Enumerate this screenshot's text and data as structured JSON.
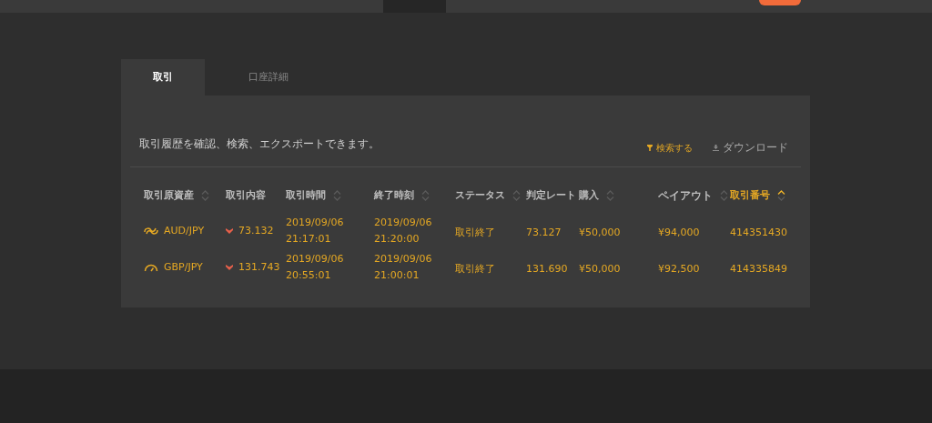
{
  "tabs": [
    {
      "label": "取引",
      "selected": true
    },
    {
      "label": "口座詳細",
      "selected": false
    }
  ],
  "panel": {
    "description": "取引履歴を確認、検索、エクスポートできます。",
    "search_button": "検索する",
    "download_button": "ダウンロード"
  },
  "table": {
    "columns": [
      {
        "label": "取引原資産",
        "sortable": true,
        "selected": false
      },
      {
        "label": "取引内容",
        "sortable": false,
        "selected": false
      },
      {
        "label": "取引時間",
        "sortable": true,
        "selected": false
      },
      {
        "label": "終了時刻",
        "sortable": true,
        "selected": false
      },
      {
        "label": "ステータス",
        "sortable": true,
        "selected": false
      },
      {
        "label": "判定レート",
        "sortable": false,
        "selected": false
      },
      {
        "label": "購入",
        "sortable": true,
        "selected": false
      },
      {
        "label": "ペイアウト",
        "sortable": true,
        "selected": false
      },
      {
        "label": "取引番号",
        "sortable": true,
        "selected": true
      }
    ],
    "rows": [
      {
        "asset": {
          "kind": "coil",
          "label": "AUD/JPY"
        },
        "content": {
          "kind": "down",
          "price": "73.132"
        },
        "start_date": "2019/09/06",
        "start_time": "21:17:01",
        "end_date": "2019/09/06",
        "end_time": "21:20:00",
        "status": "取引終了",
        "rate": "73.127",
        "purchase": "¥50,000",
        "payout": "¥94,000",
        "trade_no": "414351430"
      },
      {
        "asset": {
          "kind": "gauge",
          "label": "GBP/JPY"
        },
        "content": {
          "kind": "down",
          "price": "131.743"
        },
        "start_date": "2019/09/06",
        "start_time": "20:55:01",
        "end_date": "2019/09/06",
        "end_time": "21:00:01",
        "status": "取引終了",
        "rate": "131.690",
        "purchase": "¥50,000",
        "payout": "¥92,500",
        "trade_no": "414335849"
      }
    ]
  }
}
